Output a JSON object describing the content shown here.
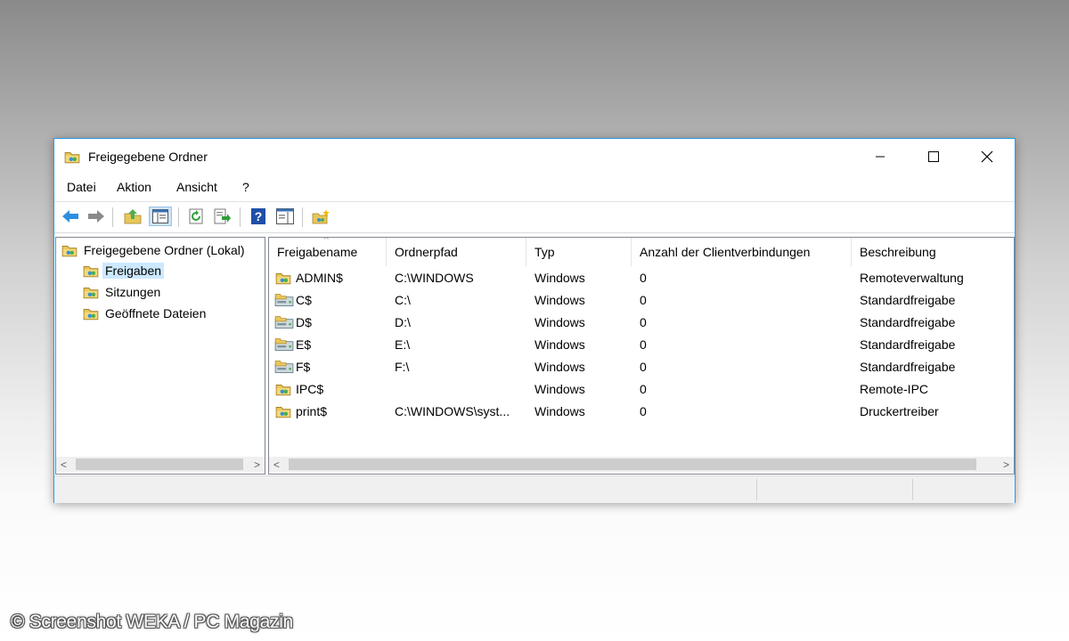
{
  "window": {
    "title": "Freigegebene Ordner",
    "icon": "shared-folder-icon",
    "controls": {
      "minimize": "—",
      "maximize": "☐",
      "close": "✕"
    }
  },
  "menu": [
    "Datei",
    "Aktion",
    "Ansicht",
    "?"
  ],
  "toolbar": [
    "back-arrow-icon",
    "forward-arrow-icon",
    "up-folder-icon",
    "show-hide-console-tree-icon",
    "refresh-icon",
    "export-list-icon",
    "help-icon",
    "action-pane-icon",
    "new-share-icon"
  ],
  "tree": {
    "root": "Freigegebene Ordner (Lokal)",
    "children": [
      "Freigaben",
      "Sitzungen",
      "Geöffnete Dateien"
    ],
    "selected": "Freigaben"
  },
  "table": {
    "columns": [
      "Freigabename",
      "Ordnerpfad",
      "Typ",
      "Anzahl der Clientverbindungen",
      "Beschreibung"
    ],
    "sort_indicator": "^",
    "rows": [
      {
        "name": "ADMIN$",
        "path": "C:\\WINDOWS",
        "type": "Windows",
        "connections": "0",
        "description": "Remoteverwaltung",
        "icon": "shared-folder-icon"
      },
      {
        "name": "C$",
        "path": "C:\\",
        "type": "Windows",
        "connections": "0",
        "description": "Standardfreigabe",
        "icon": "shared-drive-icon"
      },
      {
        "name": "D$",
        "path": "D:\\",
        "type": "Windows",
        "connections": "0",
        "description": "Standardfreigabe",
        "icon": "shared-drive-icon"
      },
      {
        "name": "E$",
        "path": "E:\\",
        "type": "Windows",
        "connections": "0",
        "description": "Standardfreigabe",
        "icon": "shared-drive-icon"
      },
      {
        "name": "F$",
        "path": "F:\\",
        "type": "Windows",
        "connections": "0",
        "description": "Standardfreigabe",
        "icon": "shared-drive-icon"
      },
      {
        "name": "IPC$",
        "path": "",
        "type": "Windows",
        "connections": "0",
        "description": "Remote-IPC",
        "icon": "shared-folder-icon"
      },
      {
        "name": "print$",
        "path": "C:\\WINDOWS\\syst...",
        "type": "Windows",
        "connections": "0",
        "description": "Druckertreiber",
        "icon": "shared-folder-icon"
      }
    ]
  },
  "scroll": {
    "left_arrow": "<",
    "right_arrow": ">"
  },
  "copyright": "© Screenshot WEKA / PC Magazin",
  "colors": {
    "window_border": "#2b9be3",
    "selection": "#cce8ff",
    "folder_yellow": "#e8c75a"
  }
}
